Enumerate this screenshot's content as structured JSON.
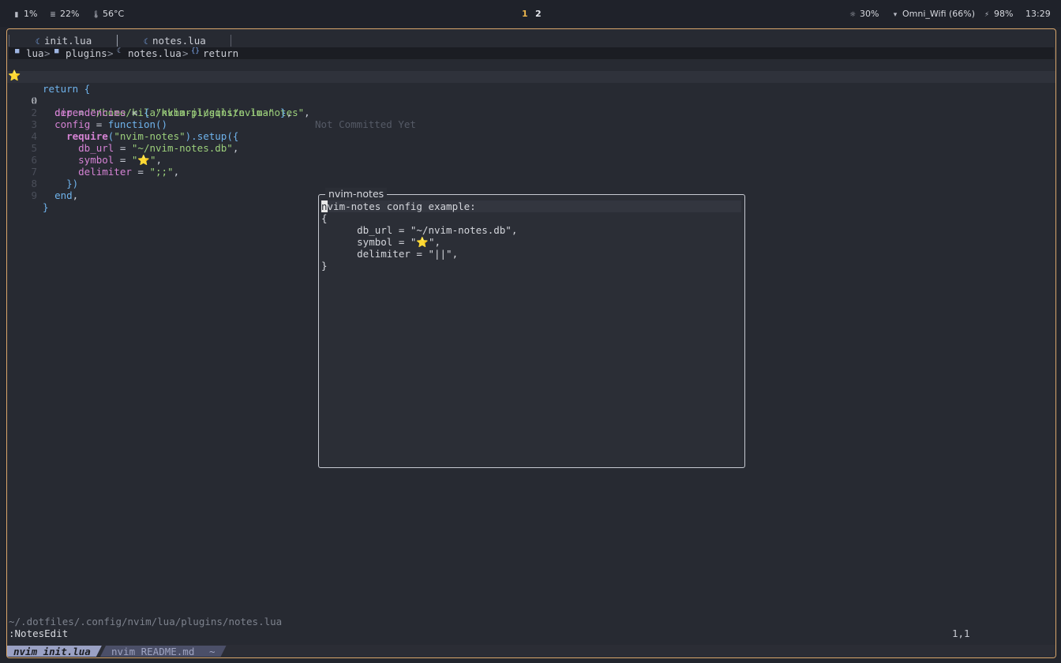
{
  "topbar": {
    "cpu": "1%",
    "memory": "22%",
    "temperature": "56°C",
    "workspaces": [
      "1",
      "2"
    ],
    "brightness": "30%",
    "wifi": "Omni_Wifi (66%)",
    "battery": "98%",
    "clock": "13:29"
  },
  "tabs": [
    {
      "label": "init.lua"
    },
    {
      "label": "notes.lua"
    }
  ],
  "breadcrumb": {
    "dir1": "lua",
    "dir2": "plugins",
    "file": "notes.lua",
    "symbol": "return"
  },
  "editor": {
    "blame": "Not Committed Yet",
    "sign_symbol": "⭐",
    "line_numbers": [
      "1",
      "0",
      "1",
      "2",
      "3",
      "4",
      "5",
      "6",
      "7",
      "8",
      "9"
    ],
    "tokens": {
      "return": "return",
      "brace_open": " {",
      "dir_key": "dir",
      "dir_val": "\"/home/kila/nvim-plugins/nvim-notes\"",
      "deps_key": "dependencies",
      "deps_val": "\"kkharji/sqlite.lua\"",
      "config_key": "config",
      "function_kw": "function",
      "require_kw": "require",
      "require_arg": "\"nvim-notes\"",
      "setup": ".setup",
      "db_url_key": "db_url",
      "db_url_val": "\"~/nvim-notes.db\"",
      "symbol_key": "symbol",
      "symbol_val": "⭐",
      "delimiter_key": "delimiter",
      "delimiter_val": "\";;\"",
      "end_kw": "end",
      "brace_close": "}"
    }
  },
  "popup": {
    "title": "nvim-notes",
    "heading_first": "n",
    "heading_rest": "vim-notes config example:",
    "open_brace": "{",
    "line_db": "      db_url = \"~/nvim-notes.db\",",
    "line_symbol_prefix": "      symbol = \"",
    "symbol": "⭐",
    "line_symbol_suffix": "\",",
    "line_delim": "      delimiter = \"||\",",
    "close_brace": "}"
  },
  "status": {
    "filepath": "~/.dotfiles/.config/nvim/lua/plugins/notes.lua",
    "command": ":NotesEdit",
    "ruler": "1,1"
  },
  "tmux": {
    "window1": "nvim init.lua",
    "window2": "nvim README.md",
    "window3": "~"
  }
}
